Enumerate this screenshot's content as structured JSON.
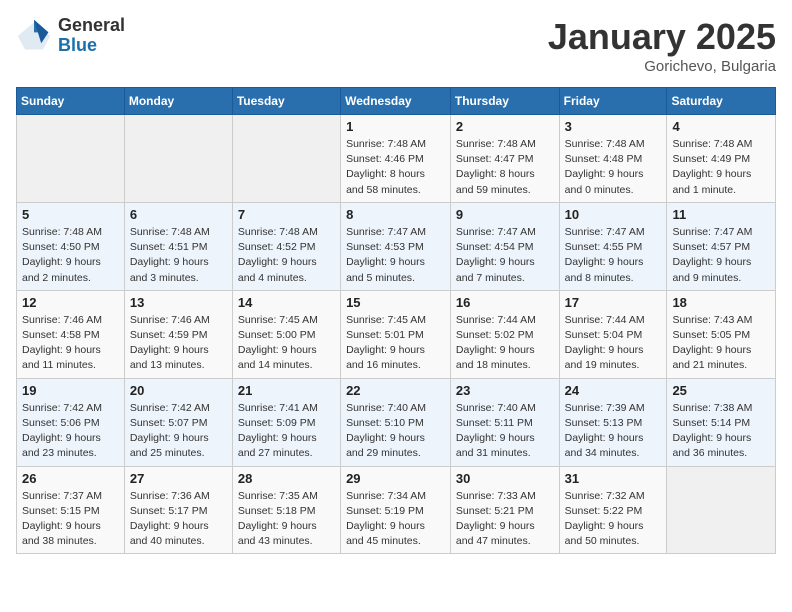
{
  "logo": {
    "general": "General",
    "blue": "Blue"
  },
  "title": "January 2025",
  "subtitle": "Gorichevo, Bulgaria",
  "days_of_week": [
    "Sunday",
    "Monday",
    "Tuesday",
    "Wednesday",
    "Thursday",
    "Friday",
    "Saturday"
  ],
  "weeks": [
    [
      {
        "day": "",
        "text": ""
      },
      {
        "day": "",
        "text": ""
      },
      {
        "day": "",
        "text": ""
      },
      {
        "day": "1",
        "text": "Sunrise: 7:48 AM\nSunset: 4:46 PM\nDaylight: 8 hours and 58 minutes."
      },
      {
        "day": "2",
        "text": "Sunrise: 7:48 AM\nSunset: 4:47 PM\nDaylight: 8 hours and 59 minutes."
      },
      {
        "day": "3",
        "text": "Sunrise: 7:48 AM\nSunset: 4:48 PM\nDaylight: 9 hours and 0 minutes."
      },
      {
        "day": "4",
        "text": "Sunrise: 7:48 AM\nSunset: 4:49 PM\nDaylight: 9 hours and 1 minute."
      }
    ],
    [
      {
        "day": "5",
        "text": "Sunrise: 7:48 AM\nSunset: 4:50 PM\nDaylight: 9 hours and 2 minutes."
      },
      {
        "day": "6",
        "text": "Sunrise: 7:48 AM\nSunset: 4:51 PM\nDaylight: 9 hours and 3 minutes."
      },
      {
        "day": "7",
        "text": "Sunrise: 7:48 AM\nSunset: 4:52 PM\nDaylight: 9 hours and 4 minutes."
      },
      {
        "day": "8",
        "text": "Sunrise: 7:47 AM\nSunset: 4:53 PM\nDaylight: 9 hours and 5 minutes."
      },
      {
        "day": "9",
        "text": "Sunrise: 7:47 AM\nSunset: 4:54 PM\nDaylight: 9 hours and 7 minutes."
      },
      {
        "day": "10",
        "text": "Sunrise: 7:47 AM\nSunset: 4:55 PM\nDaylight: 9 hours and 8 minutes."
      },
      {
        "day": "11",
        "text": "Sunrise: 7:47 AM\nSunset: 4:57 PM\nDaylight: 9 hours and 9 minutes."
      }
    ],
    [
      {
        "day": "12",
        "text": "Sunrise: 7:46 AM\nSunset: 4:58 PM\nDaylight: 9 hours and 11 minutes."
      },
      {
        "day": "13",
        "text": "Sunrise: 7:46 AM\nSunset: 4:59 PM\nDaylight: 9 hours and 13 minutes."
      },
      {
        "day": "14",
        "text": "Sunrise: 7:45 AM\nSunset: 5:00 PM\nDaylight: 9 hours and 14 minutes."
      },
      {
        "day": "15",
        "text": "Sunrise: 7:45 AM\nSunset: 5:01 PM\nDaylight: 9 hours and 16 minutes."
      },
      {
        "day": "16",
        "text": "Sunrise: 7:44 AM\nSunset: 5:02 PM\nDaylight: 9 hours and 18 minutes."
      },
      {
        "day": "17",
        "text": "Sunrise: 7:44 AM\nSunset: 5:04 PM\nDaylight: 9 hours and 19 minutes."
      },
      {
        "day": "18",
        "text": "Sunrise: 7:43 AM\nSunset: 5:05 PM\nDaylight: 9 hours and 21 minutes."
      }
    ],
    [
      {
        "day": "19",
        "text": "Sunrise: 7:42 AM\nSunset: 5:06 PM\nDaylight: 9 hours and 23 minutes."
      },
      {
        "day": "20",
        "text": "Sunrise: 7:42 AM\nSunset: 5:07 PM\nDaylight: 9 hours and 25 minutes."
      },
      {
        "day": "21",
        "text": "Sunrise: 7:41 AM\nSunset: 5:09 PM\nDaylight: 9 hours and 27 minutes."
      },
      {
        "day": "22",
        "text": "Sunrise: 7:40 AM\nSunset: 5:10 PM\nDaylight: 9 hours and 29 minutes."
      },
      {
        "day": "23",
        "text": "Sunrise: 7:40 AM\nSunset: 5:11 PM\nDaylight: 9 hours and 31 minutes."
      },
      {
        "day": "24",
        "text": "Sunrise: 7:39 AM\nSunset: 5:13 PM\nDaylight: 9 hours and 34 minutes."
      },
      {
        "day": "25",
        "text": "Sunrise: 7:38 AM\nSunset: 5:14 PM\nDaylight: 9 hours and 36 minutes."
      }
    ],
    [
      {
        "day": "26",
        "text": "Sunrise: 7:37 AM\nSunset: 5:15 PM\nDaylight: 9 hours and 38 minutes."
      },
      {
        "day": "27",
        "text": "Sunrise: 7:36 AM\nSunset: 5:17 PM\nDaylight: 9 hours and 40 minutes."
      },
      {
        "day": "28",
        "text": "Sunrise: 7:35 AM\nSunset: 5:18 PM\nDaylight: 9 hours and 43 minutes."
      },
      {
        "day": "29",
        "text": "Sunrise: 7:34 AM\nSunset: 5:19 PM\nDaylight: 9 hours and 45 minutes."
      },
      {
        "day": "30",
        "text": "Sunrise: 7:33 AM\nSunset: 5:21 PM\nDaylight: 9 hours and 47 minutes."
      },
      {
        "day": "31",
        "text": "Sunrise: 7:32 AM\nSunset: 5:22 PM\nDaylight: 9 hours and 50 minutes."
      },
      {
        "day": "",
        "text": ""
      }
    ]
  ]
}
